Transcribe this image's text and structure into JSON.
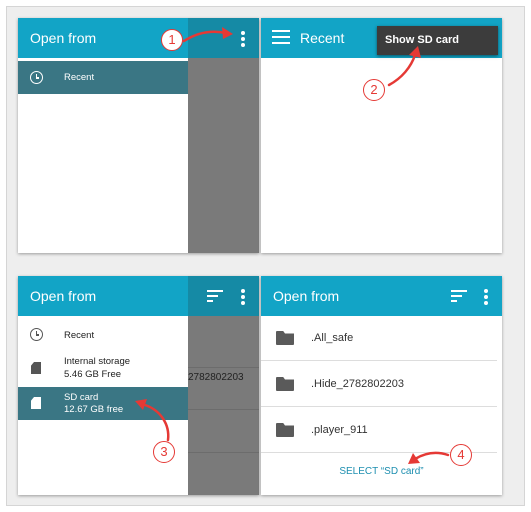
{
  "colors": {
    "accent": "#12a4c6",
    "drawer_selected": "#3a7684",
    "scrim": "#7a7a7a",
    "callout": "#e53935",
    "menu_popup": "#3c3c3c",
    "link": "#1e8fb0"
  },
  "panel1": {
    "title": "Open from",
    "overflow_icon": "overflow-menu-icon",
    "drawer_items": [
      {
        "label": "Recent",
        "icon": "clock-icon",
        "selected": true
      }
    ]
  },
  "panel2": {
    "title": "Recent",
    "menu_icon": "hamburger-menu-icon",
    "popup_item": "Show SD card"
  },
  "panel3": {
    "title": "Open from",
    "drawer_items": [
      {
        "label": "Recent",
        "sub": "",
        "icon": "clock-icon",
        "selected": false
      },
      {
        "label": "Internal storage",
        "sub": "5.46 GB Free",
        "icon": "storage-icon",
        "selected": false
      },
      {
        "label": "SD card",
        "sub": "12.67 GB free",
        "icon": "sd-card-icon",
        "selected": true
      }
    ],
    "background_fragment": "2782802203"
  },
  "panel4": {
    "title": "Open from",
    "folders": [
      {
        "name": ".All_safe",
        "icon": "folder-icon"
      },
      {
        "name": ".Hide_2782802203",
        "icon": "folder-icon"
      },
      {
        "name": ".player_911",
        "icon": "folder-icon"
      }
    ],
    "select_button": "SELECT “SD card”"
  },
  "steps": [
    "1",
    "2",
    "3",
    "4"
  ]
}
